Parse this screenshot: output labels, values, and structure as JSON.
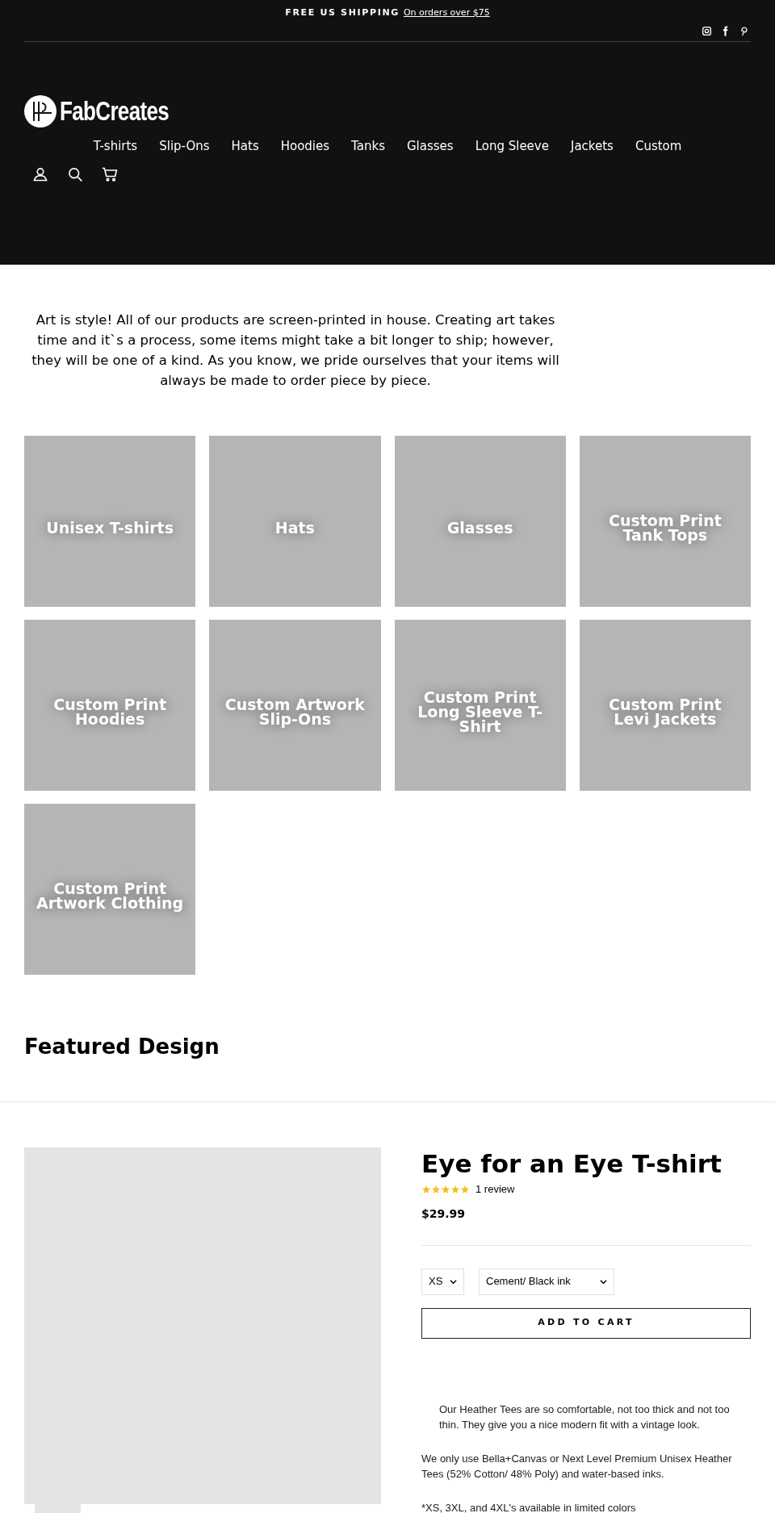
{
  "announcement": {
    "label": "FREE US SHIPPING",
    "link": "On orders over $75"
  },
  "social_links": [
    {
      "kind": "instagram"
    },
    {
      "kind": "facebook"
    },
    {
      "kind": "pinterest"
    }
  ],
  "logo": {
    "text": "FabCreates"
  },
  "nav": [
    "T-shirts",
    "Slip-Ons",
    "Hats",
    "Hoodies",
    "Tanks",
    "Glasses",
    "Long Sleeve",
    "Jackets",
    "Custom"
  ],
  "header_icons": [
    {
      "kind": "account"
    },
    {
      "kind": "search"
    },
    {
      "kind": "cart"
    }
  ],
  "intro": "Art is style! All of our products are screen-printed in house. Creating art takes time and it`s a process, some items might take a bit longer to ship; however, they will be one of a kind. As you know, we pride ourselves that your items will always be made to order piece by piece.",
  "collections": [
    {
      "title": "Unisex T-shirts"
    },
    {
      "title": "Hats"
    },
    {
      "title": "Glasses"
    },
    {
      "title": "Custom Print Tank Tops"
    },
    {
      "title": "Custom Print Hoodies"
    },
    {
      "title": "Custom Artwork Slip-Ons"
    },
    {
      "title": "Custom Print Long Sleeve T-Shirt"
    },
    {
      "title": "Custom Print Levi Jackets"
    },
    {
      "title": "Custom Print Artwork Clothing"
    }
  ],
  "featured": {
    "heading": "Featured Design"
  },
  "product": {
    "title": "Eye for an Eye T-shirt",
    "stars": 5,
    "reviews": "1 review",
    "price": "$29.99",
    "options": [
      {
        "value": "XS"
      },
      {
        "value": "Cement/ Black ink"
      }
    ],
    "add_to_cart": "ADD TO CART",
    "description": [
      "Our Heather Tees are so comfortable, not too thick and not too thin. They give you a nice modern fit with a vintage look.",
      "We only use Bella+Canvas or Next Level Premium Unisex Heather Tees (52% Cotton/ 48% Poly) and water-based inks.",
      "*XS, 3XL, and 4XL's available in limited colors"
    ]
  }
}
